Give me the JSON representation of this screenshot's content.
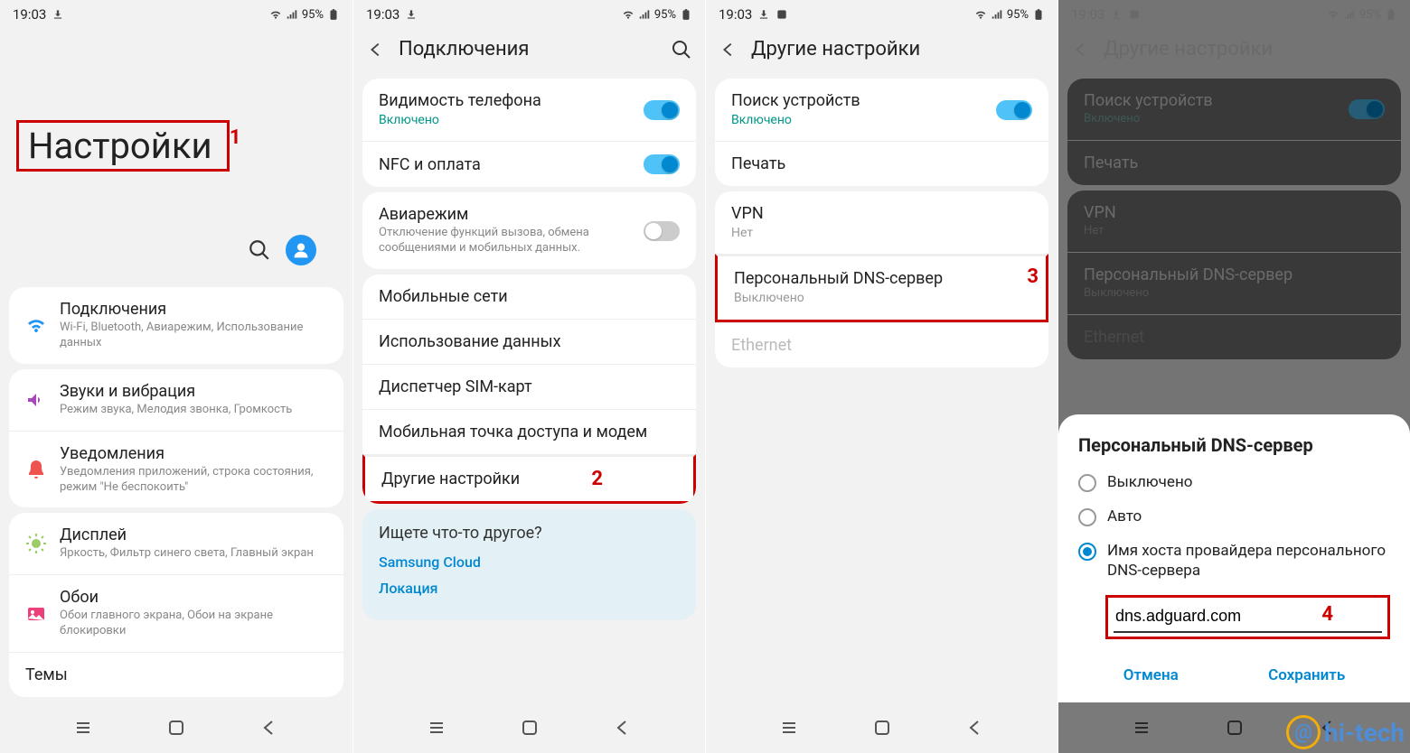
{
  "status": {
    "time": "19:03",
    "battery": "95%"
  },
  "screen1": {
    "title": "Настройки",
    "annot": "1",
    "items": [
      {
        "title": "Подключения",
        "sub": "Wi-Fi, Bluetooth, Авиарежим, Использование данных"
      },
      {
        "title": "Звуки и вибрация",
        "sub": "Режим звука, Мелодия звонка, Громкость"
      },
      {
        "title": "Уведомления",
        "sub": "Уведомления приложений, строка состояния, режим \"Не беспокоить\""
      },
      {
        "title": "Дисплей",
        "sub": "Яркость, Фильтр синего света, Главный экран"
      },
      {
        "title": "Обои",
        "sub": "Обои главного экрана, Обои на экране блокировки"
      },
      {
        "title": "Темы",
        "sub": ""
      }
    ]
  },
  "screen2": {
    "title": "Подключения",
    "group1": [
      {
        "title": "Видимость телефона",
        "sub": "Включено",
        "toggle": true
      },
      {
        "title": "NFC и оплата",
        "sub": "",
        "toggle": true
      }
    ],
    "group2": [
      {
        "title": "Авиарежим",
        "sub": "Отключение функций вызова, обмена сообщениями и мобильных данных.",
        "toggle": false
      }
    ],
    "group3": [
      {
        "title": "Мобильные сети"
      },
      {
        "title": "Использование данных"
      },
      {
        "title": "Диспетчер SIM-карт"
      },
      {
        "title": "Мобильная точка доступа и модем"
      },
      {
        "title": "Другие настройки",
        "annot": "2"
      }
    ],
    "suggest": {
      "q": "Ищете что-то другое?",
      "links": [
        "Samsung Cloud",
        "Локация"
      ]
    }
  },
  "screen3": {
    "title": "Другие настройки",
    "group1": [
      {
        "title": "Поиск устройств",
        "sub": "Включено",
        "toggle": true
      },
      {
        "title": "Печать"
      }
    ],
    "group2": [
      {
        "title": "VPN",
        "sub": "Нет"
      },
      {
        "title": "Персональный DNS-сервер",
        "sub": "Выключено",
        "annot": "3"
      },
      {
        "title": "Ethernet",
        "disabled": true
      }
    ]
  },
  "screen4": {
    "title": "Другие настройки",
    "group1": [
      {
        "title": "Поиск устройств",
        "sub": "Включено",
        "toggle": true
      },
      {
        "title": "Печать"
      }
    ],
    "group2": [
      {
        "title": "VPN",
        "sub": "Нет"
      },
      {
        "title": "Персональный DNS-сервер",
        "sub": "Выключено"
      },
      {
        "title": "Ethernet",
        "disabled": true
      }
    ],
    "dialog": {
      "title": "Персональный DNS-сервер",
      "options": [
        {
          "label": "Выключено",
          "selected": false
        },
        {
          "label": "Авто",
          "selected": false
        },
        {
          "label": "Имя хоста провайдера персонального DNS-сервера",
          "selected": true
        }
      ],
      "input": "dns.adguard.com",
      "annot": "4",
      "cancel": "Отмена",
      "save": "Сохранить"
    }
  },
  "watermark": "hi-tech"
}
